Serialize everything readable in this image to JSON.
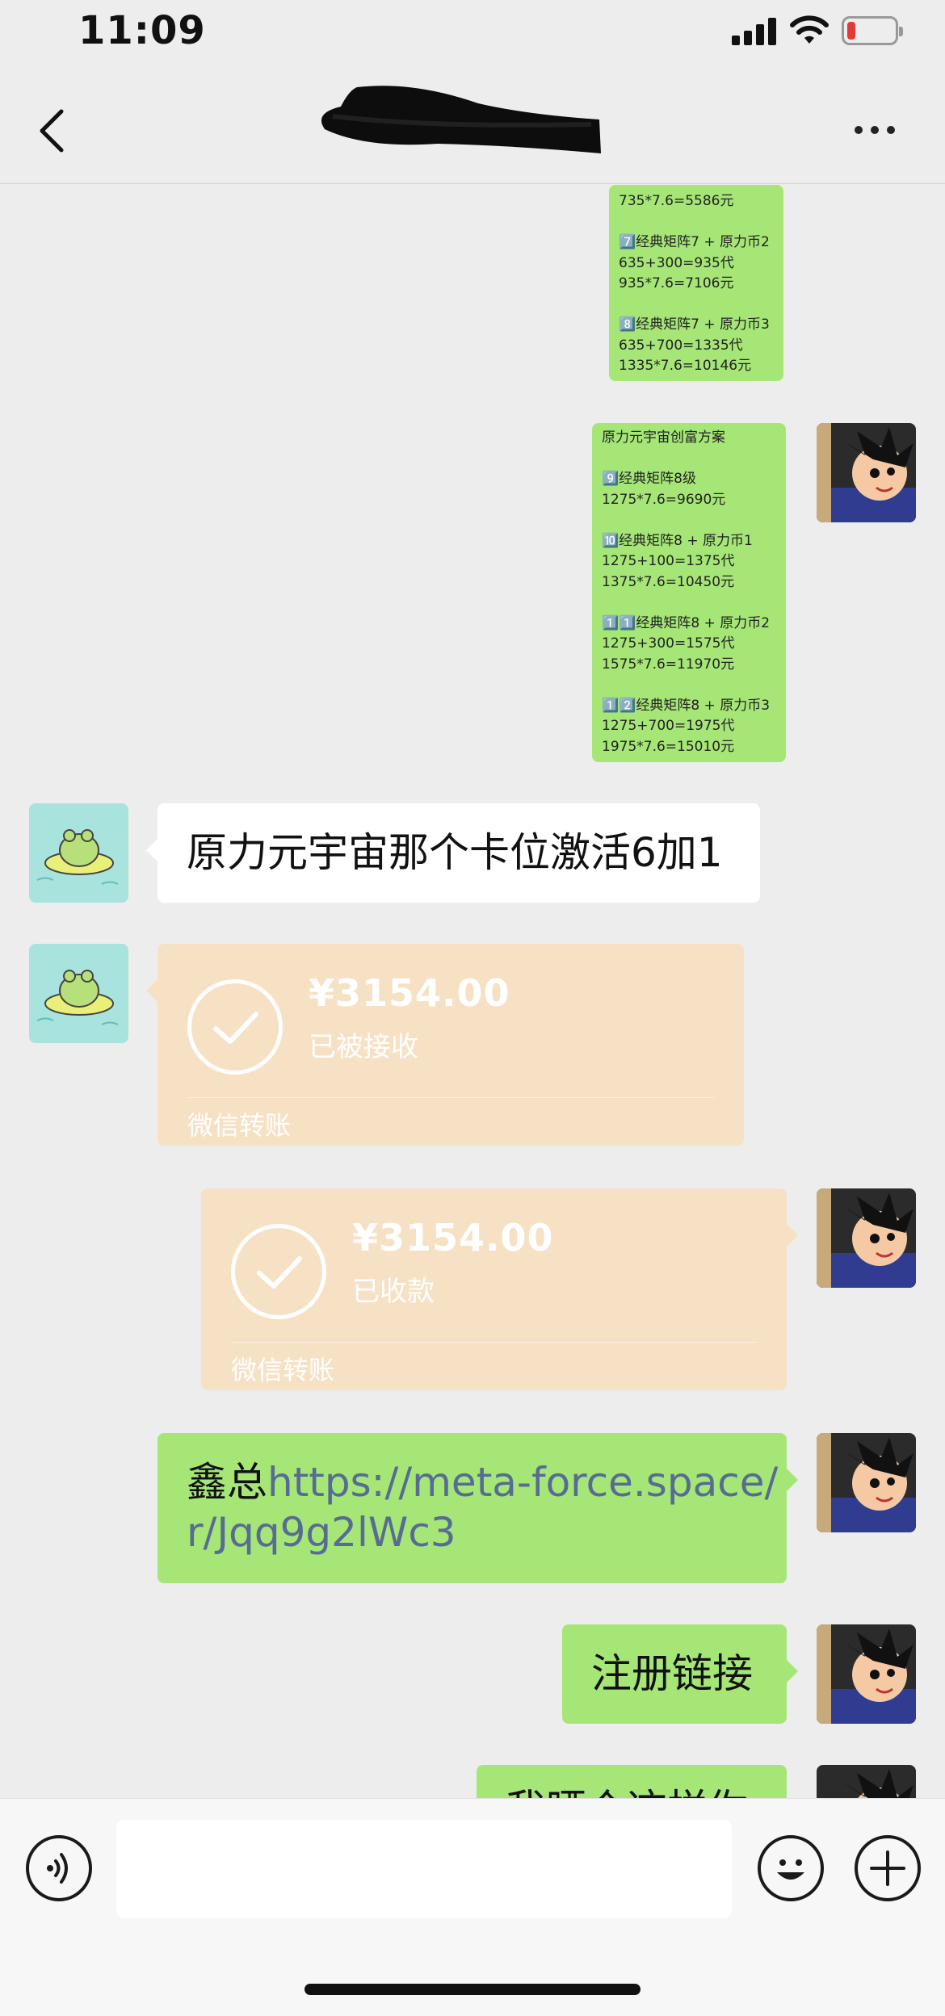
{
  "status_bar": {
    "time": "11:09"
  },
  "nav": {
    "title": ""
  },
  "messages": {
    "m1_text": "735*7.6=5586元\n\n7️⃣经典矩阵7 + 原力币2\n635+300=935代\n935*7.6=7106元\n\n8️⃣经典矩阵7 + 原力币3\n635+700=1335代\n1335*7.6=10146元",
    "m2_text": "原力元宇宙创富方案\n\n9️⃣经典矩阵8级\n1275*7.6=9690元\n\n🔟经典矩阵8 + 原力币1\n1275+100=1375代\n1375*7.6=10450元\n\n1️⃣1️⃣经典矩阵8 + 原力币2\n1275+300=1575代\n1575*7.6=11970元\n\n1️⃣2️⃣经典矩阵8 + 原力币3\n1275+700=1975代\n1975*7.6=15010元",
    "m3_text": "原力元宇宙那个卡位激活6加1",
    "m4": {
      "amount": "¥3154.00",
      "state": "已被接收",
      "label": "微信转账"
    },
    "m5": {
      "amount": "¥3154.00",
      "state": "已收款",
      "label": "微信转账"
    },
    "m6": {
      "prefix": "鑫总",
      "link": "https://meta-force.space/\nr/Jqq9g2lWc3"
    },
    "m7_text": "注册链接",
    "m8_text": "我晒个这样你"
  },
  "colors": {
    "green_bubble": "#a5e676",
    "transfer_card": "#f7e1c4",
    "link": "#576b95"
  }
}
